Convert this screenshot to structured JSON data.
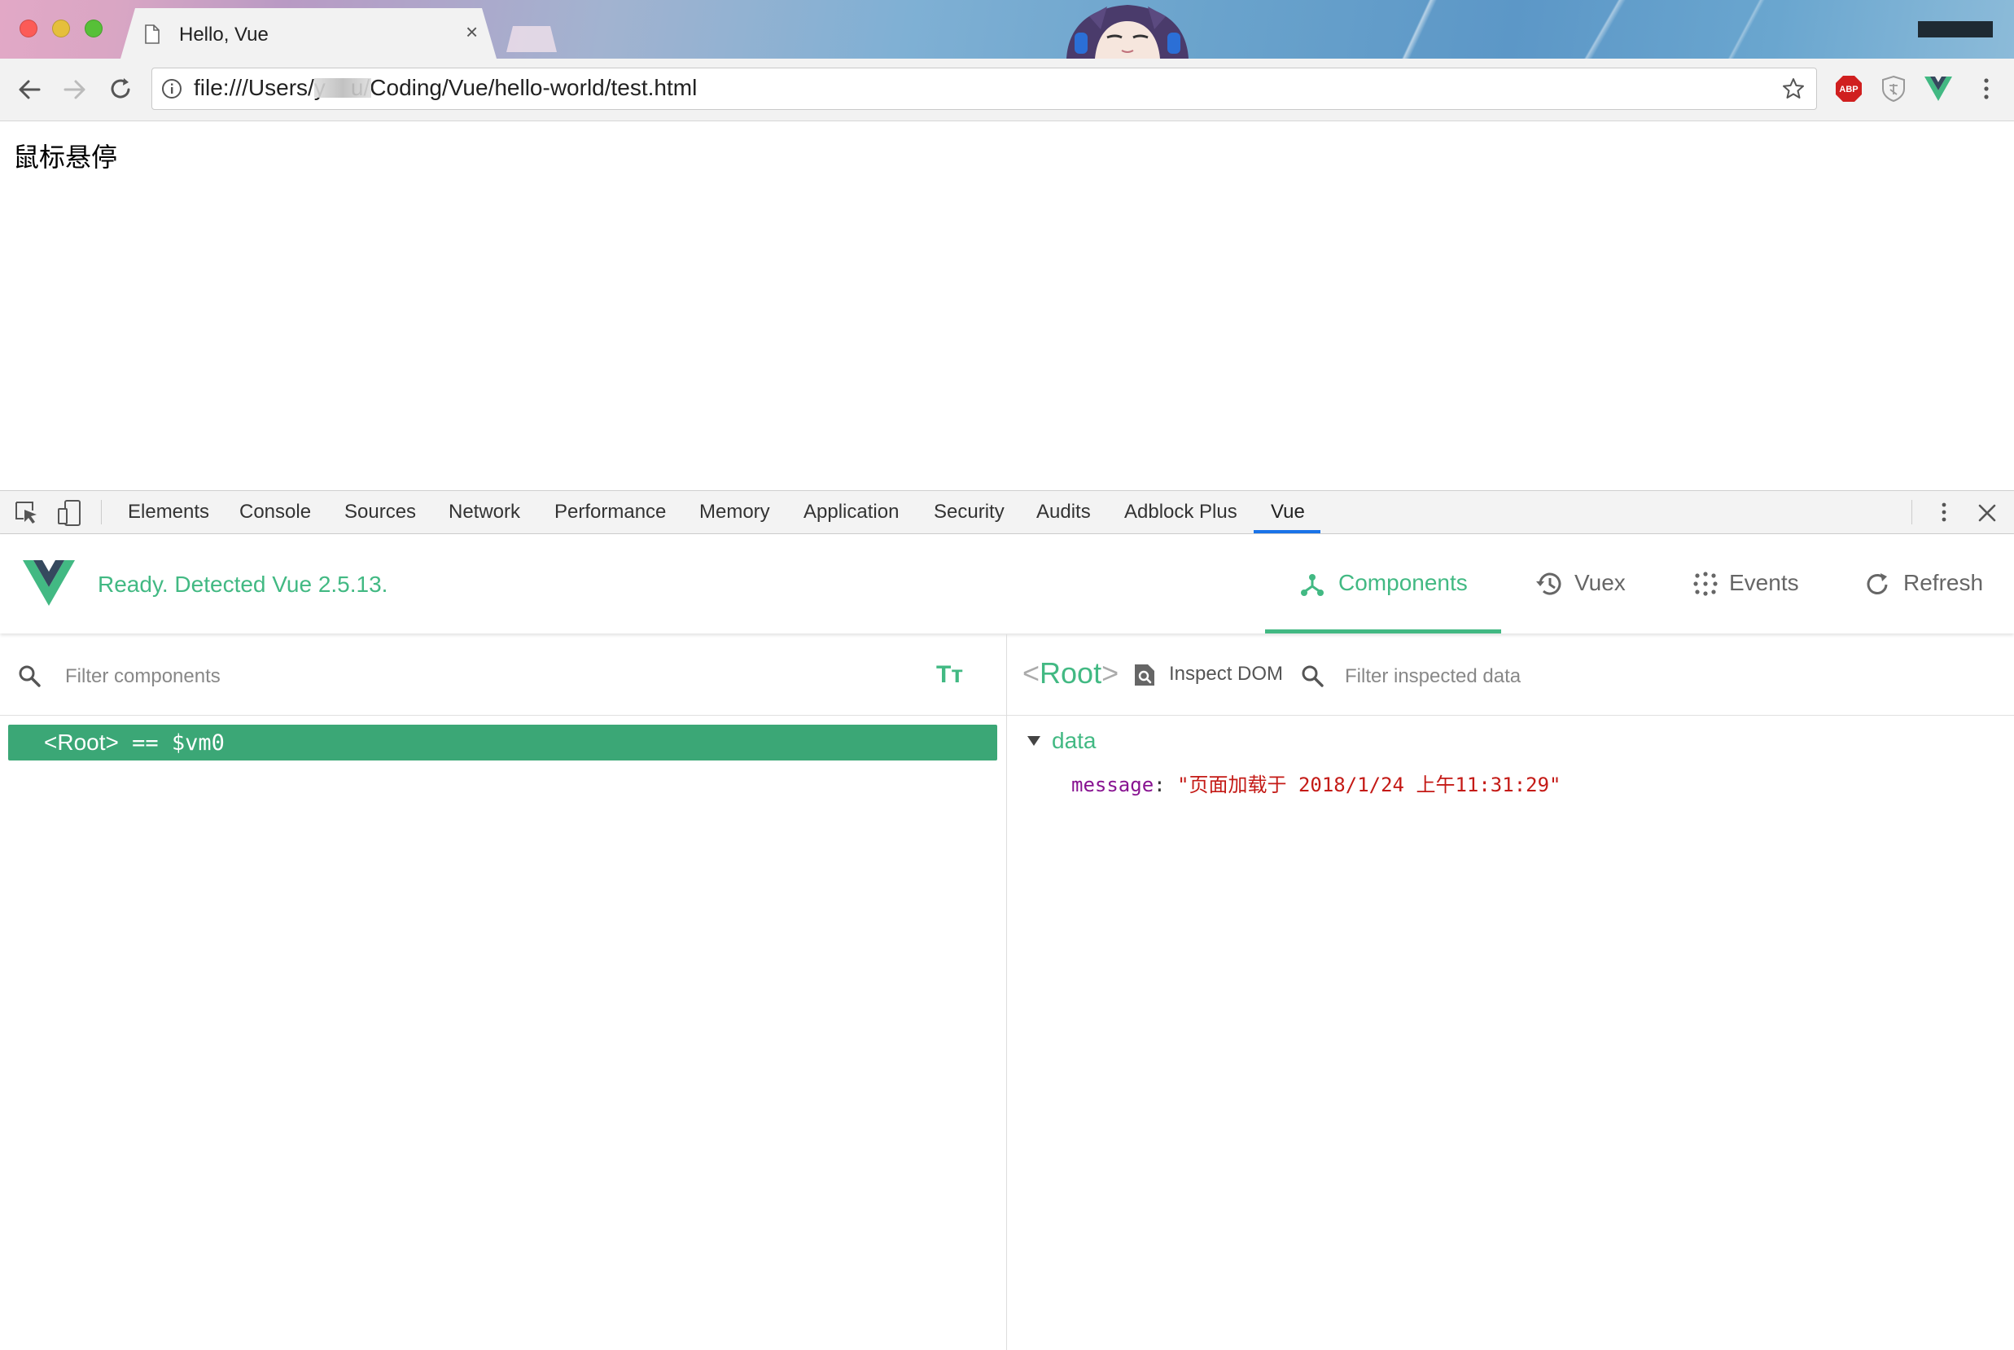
{
  "browser": {
    "tab_title": "Hello, Vue",
    "tab_close": "×",
    "url": "file:///Users/y    u/Coding/Vue/hello-world/test.html"
  },
  "page": {
    "text": "鼠标悬停"
  },
  "devtools": {
    "tabs": [
      "Elements",
      "Console",
      "Sources",
      "Network",
      "Performance",
      "Memory",
      "Application",
      "Security",
      "Audits",
      "Adblock Plus",
      "Vue"
    ],
    "active_tab": "Vue"
  },
  "vue": {
    "status": "Ready. Detected Vue 2.5.13.",
    "nav": {
      "components": "Components",
      "vuex": "Vuex",
      "events": "Events",
      "refresh": "Refresh"
    },
    "active_nav": "Components",
    "left": {
      "filter_placeholder": "Filter components",
      "tt_label": "Tт",
      "root_row": {
        "tag": "<Root>",
        "suffix": " == $vm0"
      }
    },
    "right": {
      "inspected_open": "<",
      "inspected_name": "Root",
      "inspected_close": ">",
      "inspect_dom": "Inspect DOM",
      "filter_placeholder": "Filter inspected data",
      "section": "data",
      "message_key": "message",
      "message_colon": ": ",
      "message_value": "\"页面加载于 2018/1/24 上午11:31:29\""
    }
  },
  "colors": {
    "vue_green": "#42b983",
    "selected_row": "#3ba776",
    "active_tab_underline": "#1a73e8",
    "string_value": "#c41a16",
    "property_key": "#881391"
  }
}
